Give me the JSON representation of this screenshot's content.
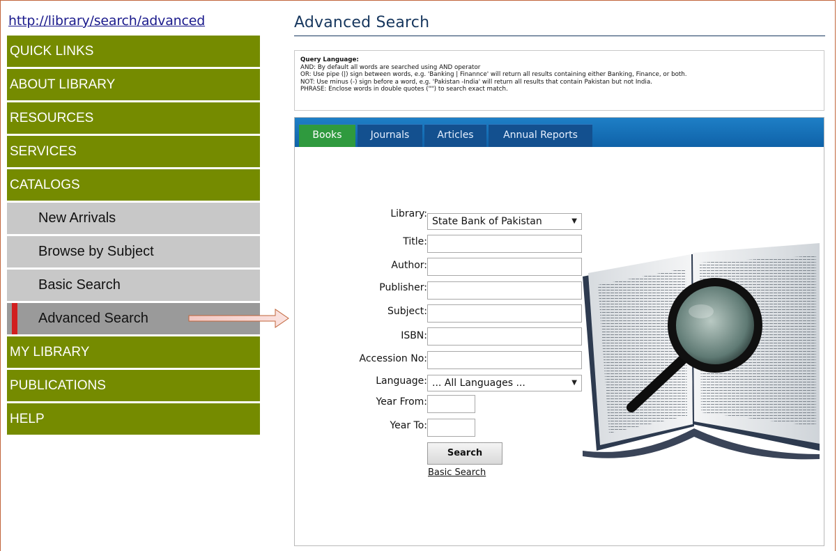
{
  "url": "http://library/search/advanced",
  "sidebar": {
    "items": [
      {
        "label": "QUICK LINKS"
      },
      {
        "label": "ABOUT LIBRARY"
      },
      {
        "label": "RESOURCES"
      },
      {
        "label": "SERVICES"
      },
      {
        "label": "CATALOGS"
      }
    ],
    "catalog_subitems": [
      {
        "label": "New Arrivals"
      },
      {
        "label": "Browse by Subject"
      },
      {
        "label": "Basic Search"
      },
      {
        "label": "Advanced Search",
        "active": true
      }
    ],
    "items_after": [
      {
        "label": "MY LIBRARY"
      },
      {
        "label": "PUBLICATIONS"
      },
      {
        "label": "HELP"
      }
    ]
  },
  "main": {
    "title": "Advanced Search",
    "query_help": {
      "heading": "Query Language:",
      "lines": [
        "AND: By default all words are searched using AND operator",
        "OR: Use pipe (|) sign between words, e.g. 'Banking | Finannce' will return all results containing either Banking, Finance, or both.",
        "NOT: Use minus (-) sign before a word, e.g. 'Pakistan -India' will return all results that contain Pakistan but not India.",
        "PHRASE: Enclose words in double quotes (\"\") to search exact match."
      ]
    },
    "tabs": [
      {
        "label": "Books",
        "active": true
      },
      {
        "label": "Journals"
      },
      {
        "label": "Articles"
      },
      {
        "label": "Annual Reports"
      }
    ],
    "form": {
      "library_label": "Library:",
      "library_value": "State Bank of Pakistan",
      "title_label": "Title:",
      "author_label": "Author:",
      "publisher_label": "Publisher:",
      "subject_label": "Subject:",
      "isbn_label": "ISBN:",
      "accession_label": "Accession No:",
      "language_label": "Language:",
      "language_value": "... All Languages ...",
      "year_from_label": "Year From:",
      "year_to_label": "Year To:",
      "search_button": "Search",
      "basic_search_link": "Basic Search"
    }
  },
  "colors": {
    "nav_green": "#758b00",
    "sub_gray": "#c8c8c8",
    "active_gray": "#9a9a9a",
    "active_marker": "#d11f1f",
    "tab_blue": "#13508f",
    "tab_active_green": "#2f9a3e",
    "frame_border": "#c0643a"
  },
  "icons": {
    "arrow": "right-arrow-icon",
    "dropdown": "caret-down-icon",
    "illustration": "book-magnifier-illustration"
  }
}
